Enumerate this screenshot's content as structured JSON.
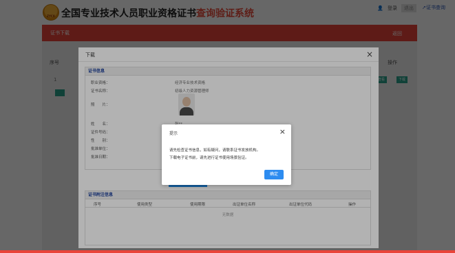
{
  "header": {
    "logo_text": "ZYCX",
    "title_main": "全国专业技术人员职业资格证书",
    "title_accent": "查询验证系统",
    "user_label": "登录",
    "grey_box": "退出",
    "cert_query": "证书查询"
  },
  "nav": {
    "active": "证书下载",
    "back": "返回"
  },
  "background": {
    "col_seq": "序号",
    "col_ops": "操作",
    "row_seq": "1",
    "btn_view": "查看",
    "btn_download": "下载"
  },
  "dialog": {
    "title": "下载",
    "close": "×",
    "info_section": "证书信息",
    "rows": [
      {
        "label": "职业资格：",
        "value": "经济专业技术资格"
      },
      {
        "label": "证书名称：",
        "value": "初级人力资源管理师"
      },
      {
        "label": "照　　片：",
        "value": ""
      },
      {
        "label": "姓　　名：",
        "value": "张**"
      },
      {
        "label": "证件号码：",
        "value": ""
      },
      {
        "label": "性　　别：",
        "value": ""
      },
      {
        "label": "批准单位：",
        "value": ""
      },
      {
        "label": "批准日期：",
        "value": ""
      }
    ],
    "record_section": "证书附注信息",
    "record_headers": [
      "序号",
      "使用类型",
      "使用期限",
      "出证单位名称",
      "出证单位代码",
      "操作"
    ],
    "no_data": "无数据"
  },
  "alert": {
    "title": "提示",
    "close": "×",
    "line1": "请先检查证书信息，如有疑问，请联系证书发放机构。",
    "line2": "下载电子证书前，请先进行证书使用场景验证。",
    "ok": "确定"
  }
}
